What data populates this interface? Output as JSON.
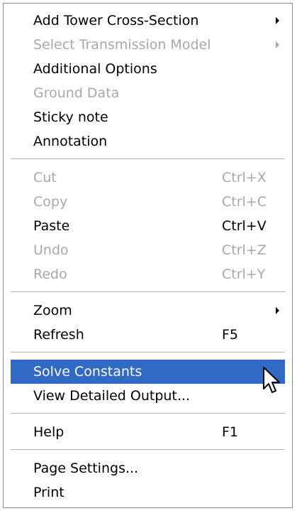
{
  "menu": {
    "group1": {
      "add_tower": "Add Tower Cross-Section",
      "select_model": "Select Transmission Model",
      "additional_options": "Additional Options",
      "ground_data": "Ground Data",
      "sticky_note": "Sticky note",
      "annotation": "Annotation"
    },
    "edit": {
      "cut": "Cut",
      "cut_shortcut": "Ctrl+X",
      "copy": "Copy",
      "copy_shortcut": "Ctrl+C",
      "paste": "Paste",
      "paste_shortcut": "Ctrl+V",
      "undo": "Undo",
      "undo_shortcut": "Ctrl+Z",
      "redo": "Redo",
      "redo_shortcut": "Ctrl+Y"
    },
    "view": {
      "zoom": "Zoom",
      "refresh": "Refresh",
      "refresh_shortcut": "F5"
    },
    "solve": {
      "solve_constants": "Solve Constants",
      "view_output": "View Detailed Output..."
    },
    "help": {
      "help": "Help",
      "help_shortcut": "F1"
    },
    "print": {
      "page_settings": "Page Settings...",
      "print": "Print"
    },
    "highlight_color": "#316ac5",
    "disabled_color": "#a8a8a8",
    "icons": [
      "submenu-arrow-icon",
      "mouse-pointer-icon"
    ]
  }
}
